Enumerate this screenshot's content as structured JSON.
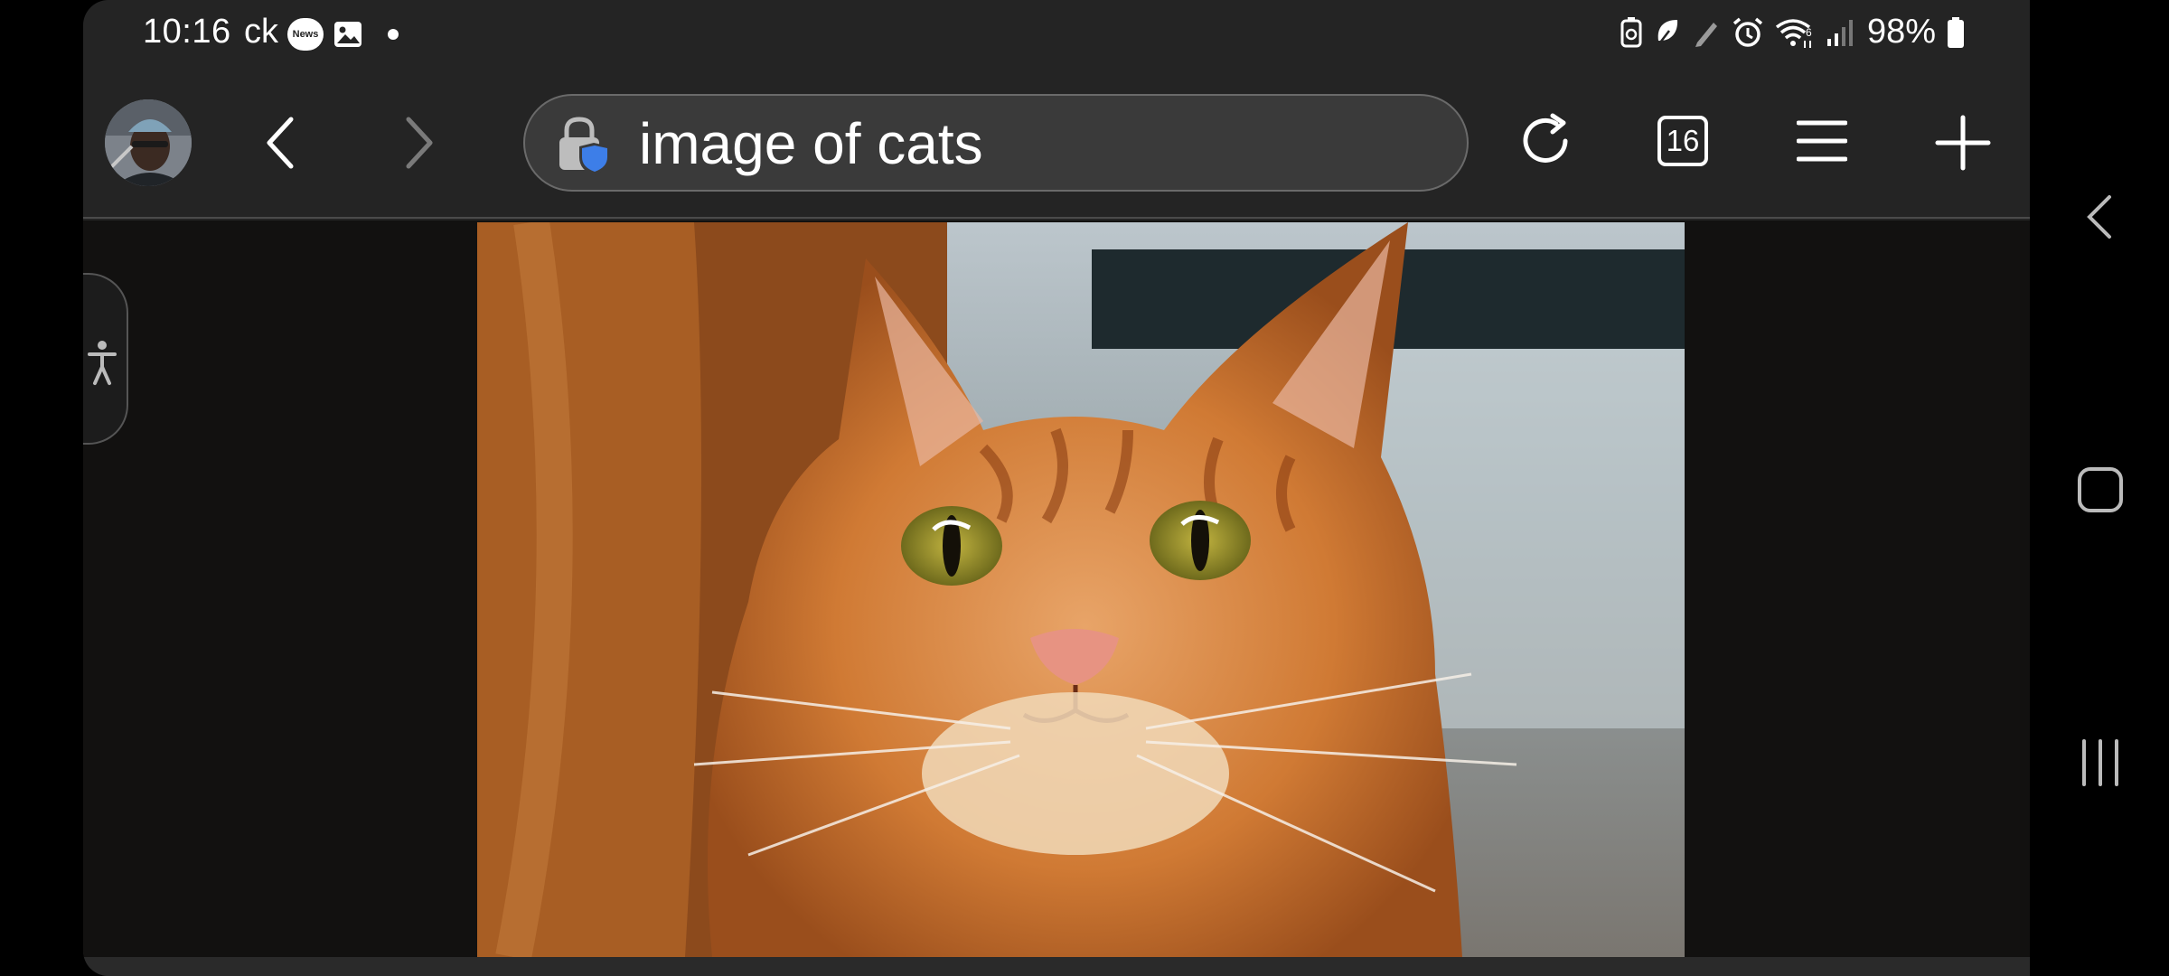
{
  "status_bar": {
    "time": "10:16",
    "carrier_text": "ck",
    "news_badge": "News",
    "battery_percent": "98%",
    "icons": [
      "news-icon",
      "gallery-icon",
      "dot-icon",
      "battery-saver-icon",
      "leaf-icon",
      "pen-icon",
      "alarm-icon",
      "wifi-6-icon",
      "signal-icon",
      "battery-icon"
    ]
  },
  "browser": {
    "address_bar_text": "image of cats",
    "tab_count": "16",
    "icons": [
      "profile-avatar",
      "back-icon",
      "forward-icon",
      "privacy-shield-lock-icon",
      "refresh-icon",
      "tabs-icon",
      "menu-icon",
      "new-tab-icon"
    ]
  },
  "content": {
    "image_subject": "orange tabby cat",
    "side_panel_icon": "accessibility-icon"
  },
  "nav_bar": {
    "icons": [
      "collapse-chevron-icon",
      "home-icon",
      "recents-icon"
    ]
  },
  "colors": {
    "screen_background": "#242424",
    "url_bar": "#3a3a3a",
    "content_background": "#121110",
    "shield_blue": "#3d7ee8"
  }
}
